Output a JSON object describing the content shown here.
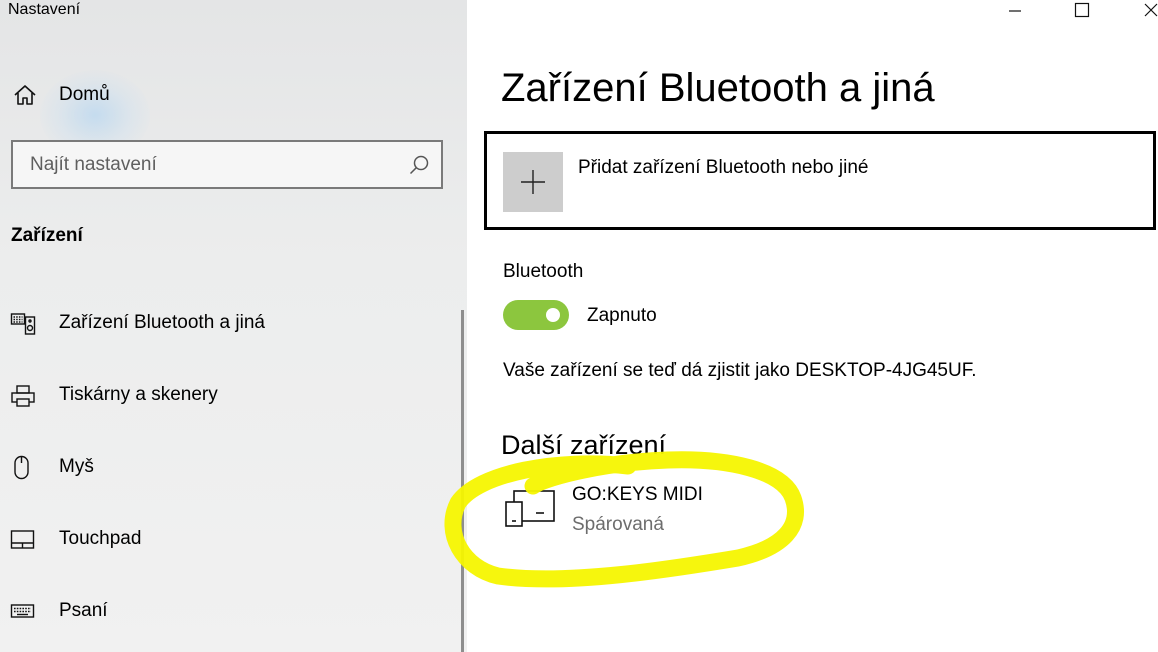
{
  "window": {
    "title": "Nastavení",
    "minimize_icon": "minimize-icon",
    "maximize_icon": "maximize-icon",
    "close_icon": "close-icon"
  },
  "sidebar": {
    "home": {
      "label": "Domů",
      "icon": "home-icon"
    },
    "search": {
      "placeholder": "Najít nastavení",
      "value": "",
      "icon": "search-icon"
    },
    "section_title": "Zařízení",
    "items": [
      {
        "label": "Zařízení Bluetooth a jiná",
        "icon": "bluetooth-devices-icon"
      },
      {
        "label": "Tiskárny a skenery",
        "icon": "printer-icon"
      },
      {
        "label": "Myš",
        "icon": "mouse-icon"
      },
      {
        "label": "Touchpad",
        "icon": "touchpad-icon"
      },
      {
        "label": "Psaní",
        "icon": "keyboard-icon"
      }
    ]
  },
  "main": {
    "title": "Zařízení Bluetooth a jiná",
    "add_device": {
      "label": "Přidat zařízení Bluetooth nebo jiné",
      "icon": "plus-icon"
    },
    "bluetooth": {
      "label": "Bluetooth",
      "state_label": "Zapnuto",
      "enabled": true
    },
    "discoverable_text": "Vaše zařízení se teď dá zjistit jako DESKTOP-4JG45UF.",
    "other_devices": {
      "title": "Další zařízení",
      "devices": [
        {
          "name": "GO:KEYS MIDI",
          "status": "Spárovaná",
          "icon": "device-icon"
        }
      ]
    }
  },
  "colors": {
    "toggle_on": "#8cc63e",
    "highlight_marker": "#f5f500",
    "sidebar_bg": "#ebebeb",
    "secondary_text": "#6d6d6d"
  }
}
